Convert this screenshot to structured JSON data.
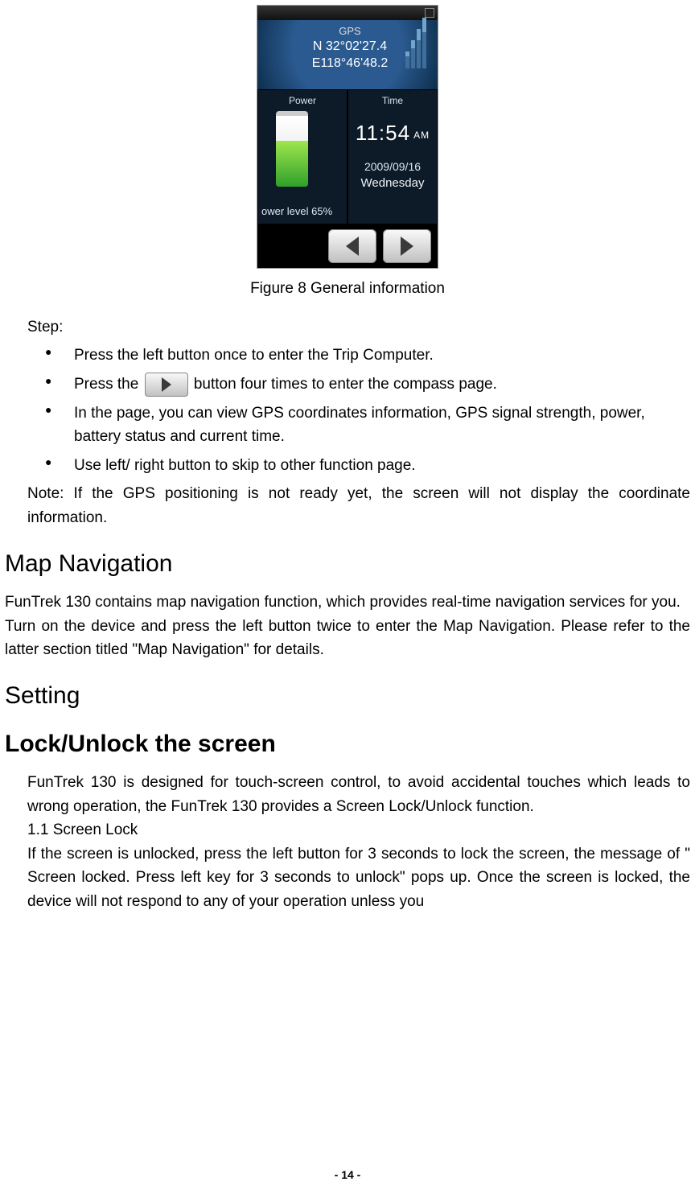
{
  "device": {
    "gps_label": "GPS",
    "lat": "N 32°02'27.4",
    "lon": "E118°46'48.2",
    "power_label": "Power",
    "power_level_text": "ower level 65%",
    "time_label": "Time",
    "time_value": "11:54",
    "time_ampm": "AM",
    "date": "2009/09/16",
    "dow": "Wednesday"
  },
  "caption": "Figure 8 General information",
  "step_label": "Step:",
  "bullets": {
    "b1": "Press the left button once to enter the Trip Computer.",
    "b2_pre": "Press the ",
    "b2_post": " button four times to enter the compass page.",
    "b3": "In the page, you can view GPS coordinates information, GPS signal strength, power, battery status and current time.",
    "b4": "Use left/ right button to skip to other function page."
  },
  "note": "Note: If the GPS positioning is not ready yet, the screen will not display the coordinate information.",
  "h_map": "Map Navigation",
  "map_p1": "FunTrek 130 contains map navigation function, which provides real-time navigation services for you.",
  "map_p2": "Turn on the device and press the left button twice to enter the Map Navigation. Please refer to the latter section titled \"Map Navigation\" for details.",
  "h_setting": "Setting",
  "h_lock": "Lock/Unlock the screen",
  "lock_p1": "FunTrek 130 is designed for touch-screen control, to avoid accidental touches which leads to wrong operation, the FunTrek 130 provides a Screen Lock/Unlock function.",
  "lock_sub": "1.1  Screen Lock",
  "lock_p2": "If the screen is unlocked, press the left button for 3 seconds to lock the screen, the message of \" Screen locked. Press left key for 3 seconds to unlock\" pops up. Once the screen is locked, the device will not respond to any of your operation unless you",
  "footer": "- 14 -"
}
